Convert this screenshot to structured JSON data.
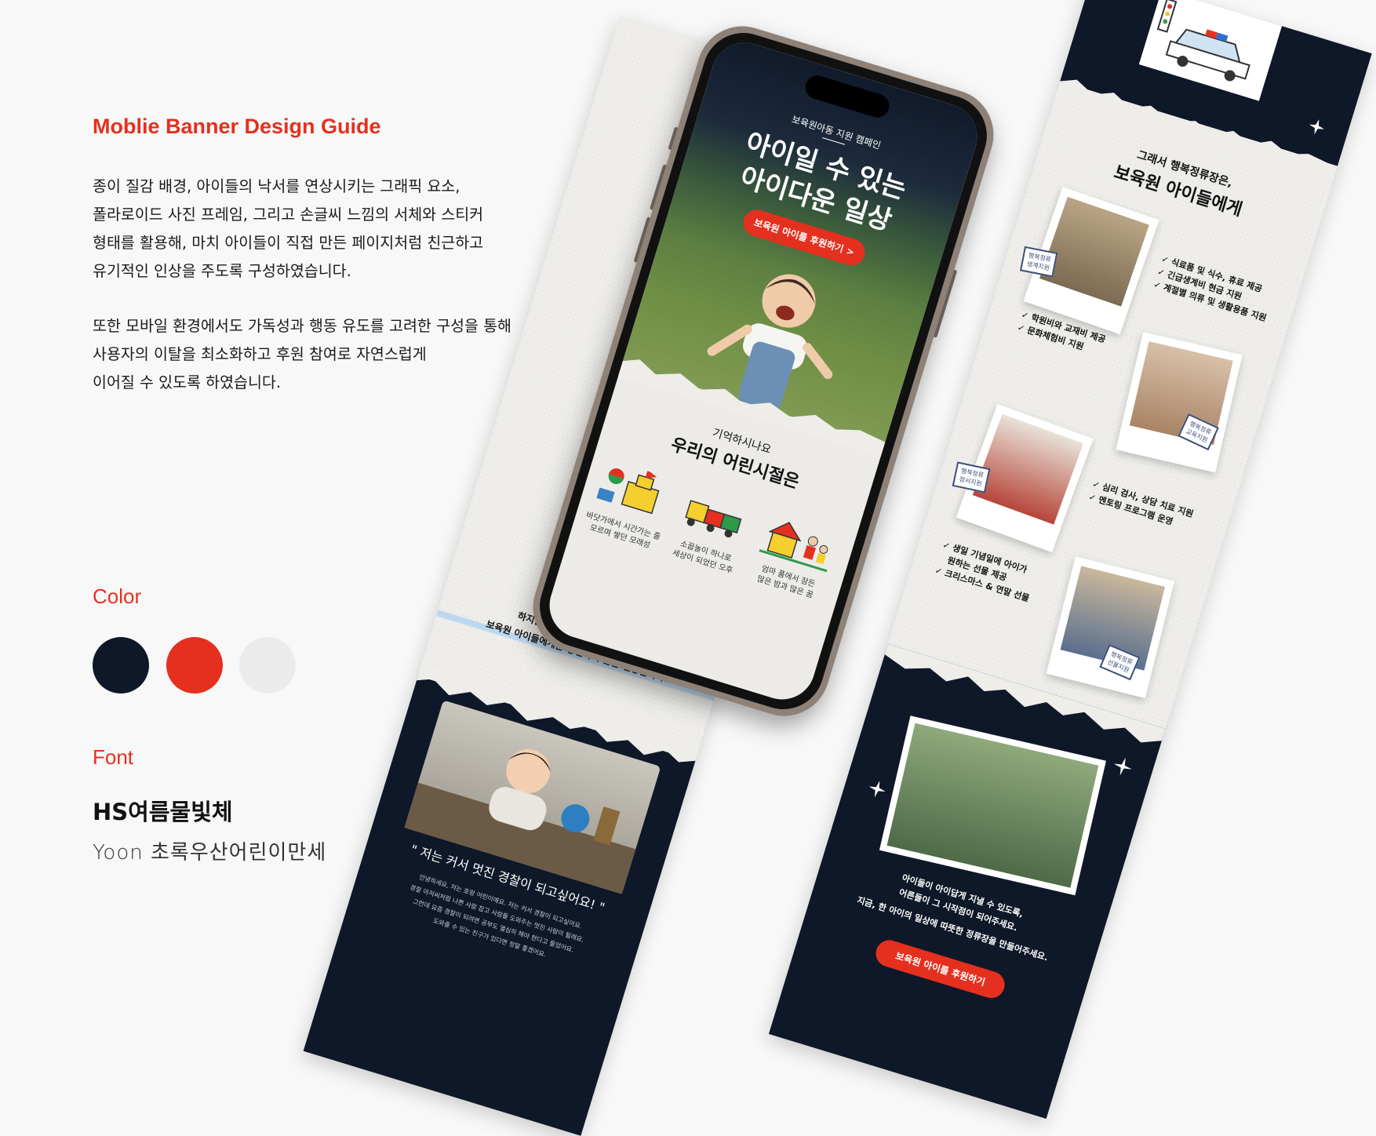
{
  "guide": {
    "title": "Moblie Banner Design Guide",
    "paragraph1": [
      "종이 질감 배경, 아이들의 낙서를 연상시키는 그래픽 요소,",
      "폴라로이드 사진 프레임, 그리고 손글씨 느낌의 서체와 스티커",
      "형태를 활용해, 마치 아이들이 직접 만든 페이지처럼 친근하고",
      "유기적인 인상을 주도록 구성하였습니다."
    ],
    "paragraph2": [
      "또한 모바일 환경에서도 가독성과 행동 유도를 고려한 구성을 통해",
      "사용자의 이탈을 최소화하고 후원 참여로 자연스럽게",
      "이어질 수 있도록 하였습니다."
    ],
    "color_label": "Color",
    "colors": [
      "#0f1828",
      "#e5301f",
      "#ebebeb"
    ],
    "font_label": "Font",
    "font_primary": "HS여름물빛체",
    "font_secondary": "Yoon 초록우산어린이만세"
  },
  "phone_screen": {
    "kicker": "보육원아동 지원 캠페인",
    "headline": [
      "아이일 수 있는",
      "아이다운 일상"
    ],
    "cta": "보육원 아이를 후원하기 >",
    "question": "기억하시나요",
    "heading": "우리의 어린시절은",
    "doodles": [
      {
        "icon": "sandcastle-icon",
        "caption": [
          "바닷가에서 시간가는 줄",
          "모르며 쌓던 모래성"
        ]
      },
      {
        "icon": "toy-train-icon",
        "caption": [
          "소꿉놀이 하나로",
          "세상이 되었던 오후"
        ]
      },
      {
        "icon": "family-house-icon",
        "caption": [
          "엄마 품에서 잠든",
          "많은 밤과 많은 꿈"
        ]
      }
    ]
  },
  "left_strip": {
    "lines": [
      "하지만 우리의 이 따뜻한 기억들이",
      "보육원 아이들에게는 당연하지 않은 일상입니다."
    ],
    "quote": "\" 저는 커서 멋진 경찰이 되고싶어요! \"",
    "small_lines": [
      "안녕하세요, 저는 호랑 어린이예요. 저는 커서 경찰이 되고싶어요.",
      "경찰 아저씨처럼 나쁜 사람 잡고 사람들 도와주는 멋진 사람이 될래요.",
      "그런데 요즘 경찰이 되려면 공부도 열심히 해야 한다고 들었어요.",
      "도와줄 수 있는 친구가 있다면 정말 좋겠어요."
    ]
  },
  "right_strip": {
    "intro": "그래서 행복정류장은,",
    "heading": "보육원 아이들에게",
    "checks_1": [
      "식료품 및 식수, 휴료 제공",
      "긴급생계비 현금 지원",
      "계절별 의류 및 생활용품 지원"
    ],
    "stamp_1": [
      "행복정류",
      "생계지원"
    ],
    "checks_2": [
      "학원비와 교재비 제공",
      "문화체험비 지원"
    ],
    "stamp_2": [
      "행복정류",
      "교육지원"
    ],
    "checks_3": [
      "심리 검사, 상담 치료 지원",
      "멘토링 프로그램 운영"
    ],
    "stamp_3": [
      "행복정류",
      "정서지원"
    ],
    "checks_4": [
      "생일 기념일에 아이가",
      "원하는 선물 제공",
      "크리스마스 & 연말 선물"
    ],
    "stamp_4": [
      "행복정류",
      "선물지원"
    ],
    "dark_lines": [
      "아이들이 아이답게 지낼 수 있도록,",
      "어른들이 그 시작점이 되어주세요.",
      "지금, 한 아이의 일상에 따뜻한 정류장을 만들어주세요."
    ],
    "cta": "보육원 아이를 후원하기"
  }
}
